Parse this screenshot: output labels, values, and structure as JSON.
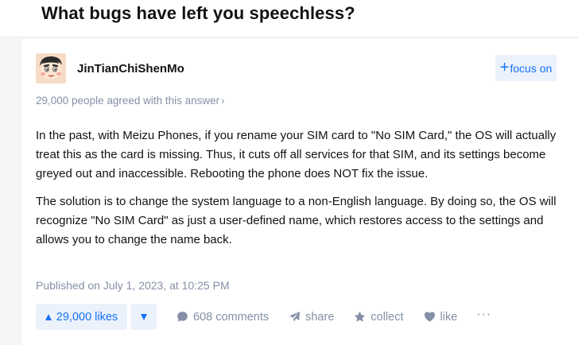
{
  "question": {
    "title": "What bugs have left you speechless?"
  },
  "author": {
    "name": "JinTianChiShenMo",
    "avatar_icon": "cartoon-avatar-icon",
    "focus_label": "focus on",
    "focus_icon": "plus-icon"
  },
  "answer": {
    "agree_text": "29,000 people agreed with this answer",
    "agree_chevron": "›",
    "paragraphs": [
      "In the past, with Meizu Phones, if you rename your SIM card to \"No SIM Card,\" the OS will actually treat this as the card is missing. Thus, it cuts off all services for that SIM, and its settings become greyed out and inaccessible. Rebooting the phone does NOT fix the issue.",
      "The solution is to change the system language to a non-English language. By doing so, the OS will recognize \"No SIM Card\" as just a user-defined name, which restores access to the settings and allows you to change the name back."
    ],
    "published": "Published on July 1, 2023, at 10:25 PM"
  },
  "actions": {
    "likes_label": "29,000 likes",
    "comments_label": "608 comments",
    "share_label": "share",
    "collect_label": "collect",
    "like_label": "like",
    "more_label": "···"
  },
  "colors": {
    "accent": "#1772f6",
    "accent_bg": "#ebf2fb",
    "muted": "#8590a6",
    "text": "#121212",
    "page_bg": "#f6f6f6"
  }
}
